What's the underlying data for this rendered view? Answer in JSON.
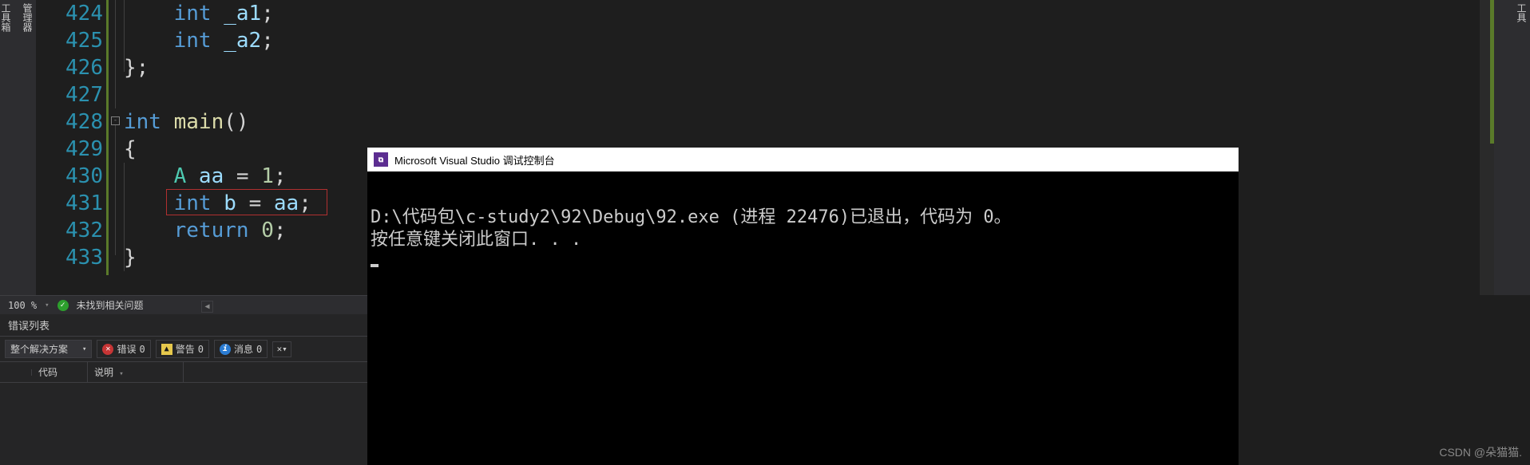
{
  "left_tabs": [
    "管理器",
    "工具箱"
  ],
  "right_tabs": [
    "工具"
  ],
  "line_numbers": [
    "424",
    "425",
    "426",
    "427",
    "428",
    "429",
    "430",
    "431",
    "432",
    "433"
  ],
  "code": {
    "l424": {
      "indent": "    ",
      "kw": "int",
      "var": " _a1",
      "end": ";"
    },
    "l425": {
      "indent": "    ",
      "kw": "int",
      "var": " _a2",
      "end": ";"
    },
    "l426": {
      "brace": "};"
    },
    "l427": {
      "blank": ""
    },
    "l428": {
      "kw": "int",
      "fn": " main",
      "paren": "()"
    },
    "l429": {
      "brace": "{"
    },
    "l430": {
      "indent": "    ",
      "typ": "A",
      "var": " aa ",
      "op": "= ",
      "num": "1",
      "end": ";"
    },
    "l431": {
      "indent": "    ",
      "kw": "int",
      "var_b": " b ",
      "op": "= ",
      "var_aa": "aa",
      "end": ";"
    },
    "l432": {
      "indent": "    ",
      "kw": "return",
      "sp": " ",
      "num": "0",
      "end": ";"
    },
    "l433": {
      "brace": "}"
    }
  },
  "zoom": "100 %",
  "no_issues": "未找到相关问题",
  "error_list": {
    "title": "错误列表",
    "scope": "整个解决方案",
    "errors_label": "错误",
    "errors_count": "0",
    "warnings_label": "警告",
    "warnings_count": "0",
    "messages_label": "消息",
    "messages_count": "0",
    "col_code": "代码",
    "col_desc": "说明"
  },
  "debug_console": {
    "title": "Microsoft Visual Studio 调试控制台",
    "line1": "D:\\代码包\\c-study2\\92\\Debug\\92.exe (进程 22476)已退出，代码为 0。",
    "line2": "按任意键关闭此窗口. . ."
  },
  "watermark": "CSDN @朵猫猫."
}
